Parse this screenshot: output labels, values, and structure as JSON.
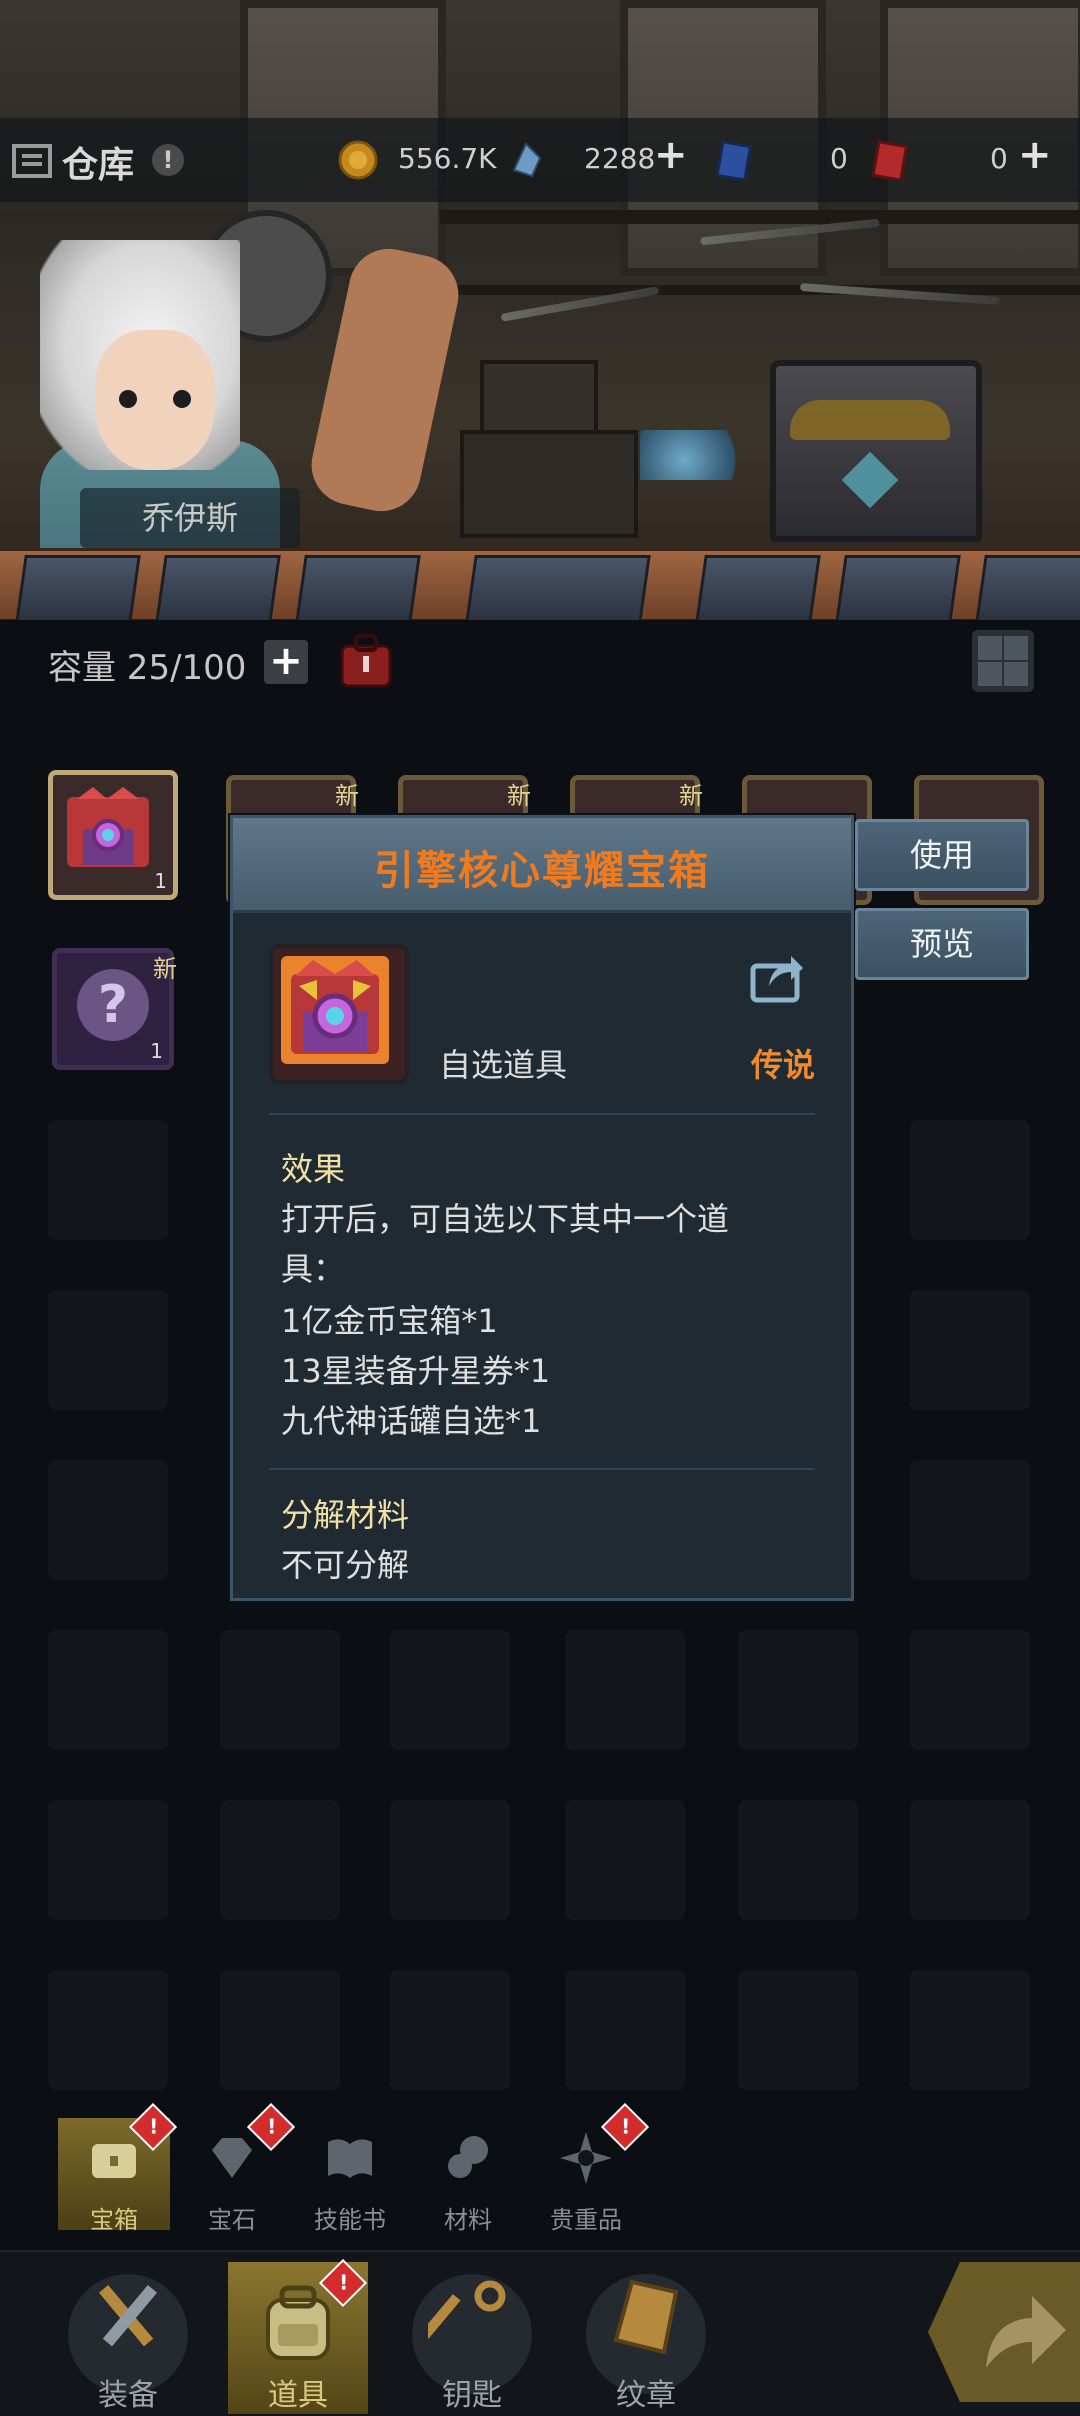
{
  "topbar": {
    "title": "仓库",
    "info_glyph": "!",
    "gold": "556.7K",
    "crystal": "2288",
    "ticket_blue": "0",
    "ticket_red": "0",
    "plus": "+"
  },
  "character": {
    "name": "乔伊斯"
  },
  "capacity": {
    "label": "容量 25/100",
    "plus": "+"
  },
  "inventory": {
    "new_label": "新",
    "count": "1",
    "mystery_glyph": "?"
  },
  "popup": {
    "title": "引擎核心尊耀宝箱",
    "item_type": "自选道具",
    "rarity": "传说",
    "effect_title": "效果",
    "effect_lines": [
      "打开后，可自选以下其中一个道",
      "具：",
      "1亿金币宝箱*1",
      "13星装备升星券*1",
      "九代神话罐自选*1"
    ],
    "decompose_title": "分解材料",
    "decompose_value": "不可分解"
  },
  "side_buttons": {
    "use": "使用",
    "preview": "预览"
  },
  "categories": [
    {
      "label": "宝箱"
    },
    {
      "label": "宝石"
    },
    {
      "label": "技能书"
    },
    {
      "label": "材料"
    },
    {
      "label": "贵重品"
    }
  ],
  "nav": [
    {
      "label": "装备"
    },
    {
      "label": "道具"
    },
    {
      "label": "钥匙"
    },
    {
      "label": "纹章"
    }
  ],
  "badge_glyph": "!",
  "colors": {
    "title_orange": "#f07a1e",
    "rarity_orange": "#f08a2c",
    "section_yellow": "#f2e1a6",
    "popup_bg": "#1f2a33",
    "badge_red": "#d22c2c"
  }
}
